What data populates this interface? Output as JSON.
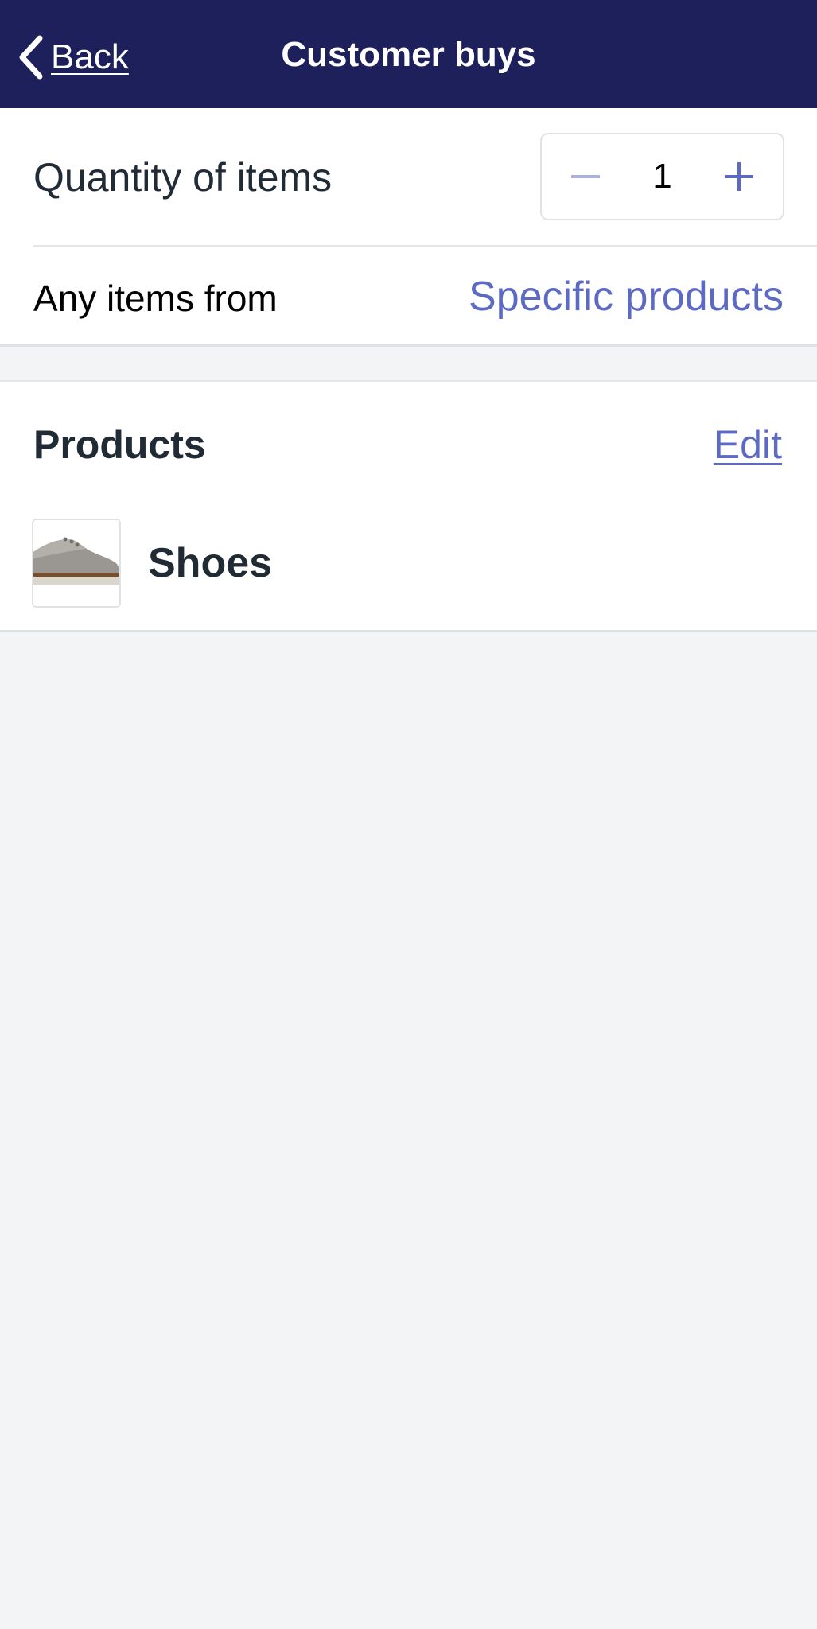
{
  "header": {
    "back_label": "Back",
    "title": "Customer buys"
  },
  "quantity": {
    "label": "Quantity of items",
    "value": "1",
    "decrement_icon": "minus-icon",
    "increment_icon": "plus-icon"
  },
  "scope": {
    "label": "Any items from",
    "value": "Specific products"
  },
  "products_section": {
    "title": "Products",
    "edit_label": "Edit",
    "items": [
      {
        "name": "Shoes",
        "thumbnail": "shoe-image"
      }
    ]
  },
  "colors": {
    "navbar": "#1d205a",
    "accent": "#5c6ac4",
    "background": "#f3f4f6"
  }
}
